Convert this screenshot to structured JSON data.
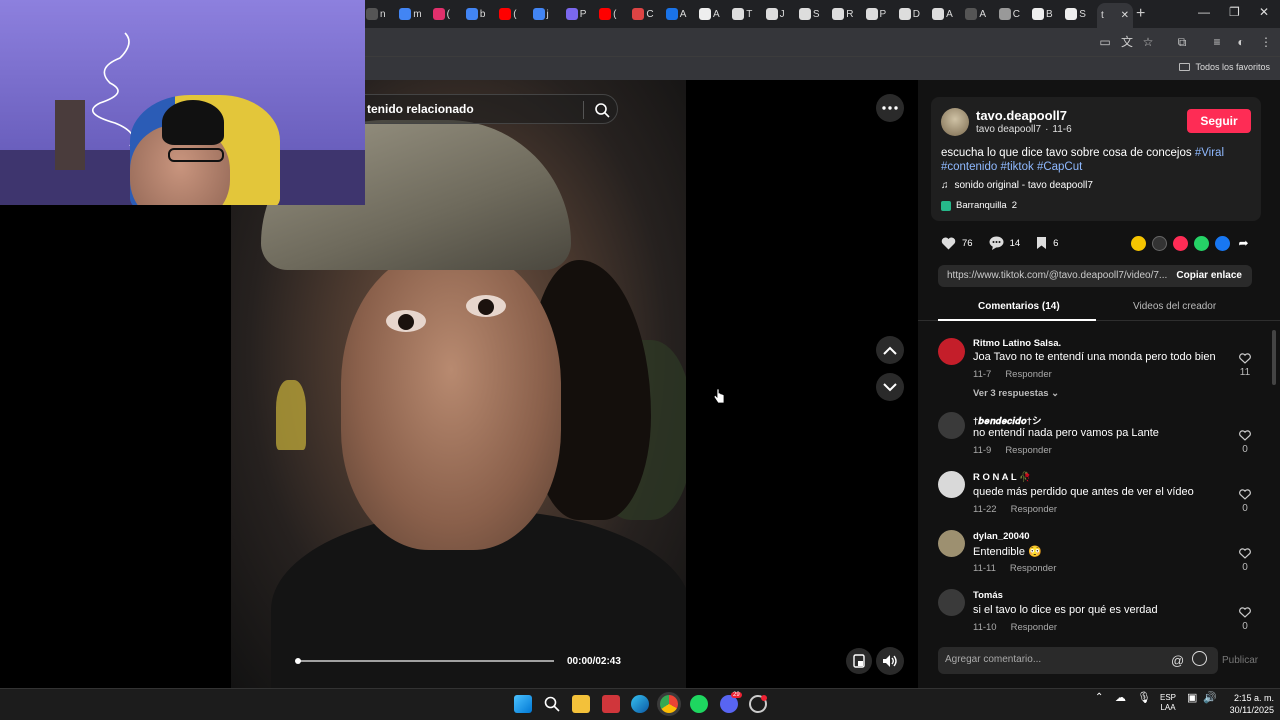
{
  "browser": {
    "active_tab_label": "t",
    "close_glyph": "✕",
    "new_tab_glyph": "+",
    "bookmarks_right_label": "Todos los favoritos",
    "tab_letters": [
      "n",
      "m",
      "(",
      "b",
      "(",
      "j",
      "P",
      "(",
      "C",
      "A",
      "A",
      "T",
      "J",
      "S",
      "R",
      "P",
      "D",
      "A",
      "A",
      "C",
      "B",
      "S"
    ]
  },
  "video": {
    "search_placeholder": "tenido relacionado",
    "time": "00:00/02:43",
    "progress": 0.0
  },
  "post": {
    "username": "tavo.deapooll7",
    "handle": "tavo deapooll7",
    "separator": "·",
    "date": "11-6",
    "follow_label": "Seguir",
    "description": "escucha lo que dice tavo sobre cosa de concejos",
    "tags": [
      "#Viral",
      "#contenido",
      "#tiktok",
      "#CapCut"
    ],
    "music": "sonido original - tavo deapooll7",
    "location": "Barranquilla",
    "location_more": "2",
    "likes": "76",
    "comments_count": "14",
    "saves": "6",
    "link": "https://www.tiktok.com/@tavo.deapooll7/video/7...",
    "copy_link_label": "Copiar enlace",
    "tab_comments": "Comentarios (14)",
    "tab_creator_videos": "Videos del creador"
  },
  "comments": [
    {
      "user": "Ritmo Latino Salsa.",
      "text": "Joa Tavo no te entendí una monda pero todo bien",
      "date": "11-7",
      "reply": "Responder",
      "likes": "11",
      "more": "Ver 3 respuestas"
    },
    {
      "user": "†𝒃𝒆𝒏𝒅𝒆𝒄𝒊𝒅𝒐†シ",
      "text": "no entendí nada pero vamos pa Lante",
      "date": "11-9",
      "reply": "Responder",
      "likes": "0"
    },
    {
      "user": "R O N A L 🥀",
      "text": "quede más perdido que antes de ver el vídeo",
      "date": "11-22",
      "reply": "Responder",
      "likes": "0"
    },
    {
      "user": "dylan_20040",
      "text": "Entendible 😳",
      "date": "11-11",
      "reply": "Responder",
      "likes": "0"
    },
    {
      "user": "Tomás",
      "text": "si el tavo lo dice es por qué es verdad",
      "date": "11-10",
      "reply": "Responder",
      "likes": "0"
    }
  ],
  "composer": {
    "placeholder": "Agregar comentario...",
    "at_glyph": "@",
    "post_label": "Publicar"
  },
  "taskbar": {
    "lang_top": "ESP",
    "lang_bottom": "LAA",
    "time": "2:15 a. m.",
    "date": "30/11/2025",
    "discord_badge": "29"
  },
  "colors": {
    "accent": "#fe2c55",
    "tag": "#8fb9ff",
    "panel": "#121212"
  }
}
